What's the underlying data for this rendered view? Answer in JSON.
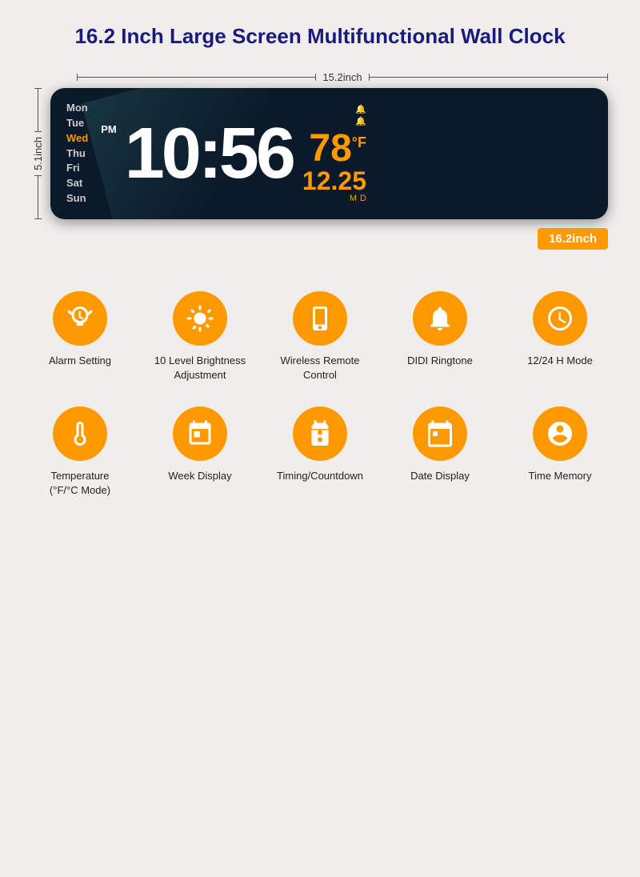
{
  "title": "16.2 Inch Large Screen Multifunctional Wall Clock",
  "dimensions": {
    "width_label": "15.2inch",
    "height_label": "5.1inch",
    "size_badge": "16.2inch"
  },
  "clock": {
    "days": [
      "Mon",
      "Tue",
      "Wed",
      "Thu",
      "Fri",
      "Sat",
      "Sun"
    ],
    "active_day": "Wed",
    "am_pm": "PM",
    "time": "10:56",
    "temp": "78",
    "temp_unit": "°F",
    "date": "12.25",
    "date_m": "M",
    "date_d": "D"
  },
  "features": [
    {
      "row": 1,
      "items": [
        {
          "id": "alarm",
          "label": "Alarm Setting"
        },
        {
          "id": "brightness",
          "label": "10 Level Brightness Adjustment"
        },
        {
          "id": "remote",
          "label": "Wireless Remote Control"
        },
        {
          "id": "ringtone",
          "label": "DIDI Ringtone"
        },
        {
          "id": "mode",
          "label": "12/24 H Mode"
        }
      ]
    },
    {
      "row": 2,
      "items": [
        {
          "id": "temperature",
          "label": "Temperature\n(°F/°C Mode)"
        },
        {
          "id": "week",
          "label": "Week Display"
        },
        {
          "id": "countdown",
          "label": "Timing/Countdown"
        },
        {
          "id": "date",
          "label": "Date Display"
        },
        {
          "id": "memory",
          "label": "Time Memory"
        }
      ]
    }
  ]
}
